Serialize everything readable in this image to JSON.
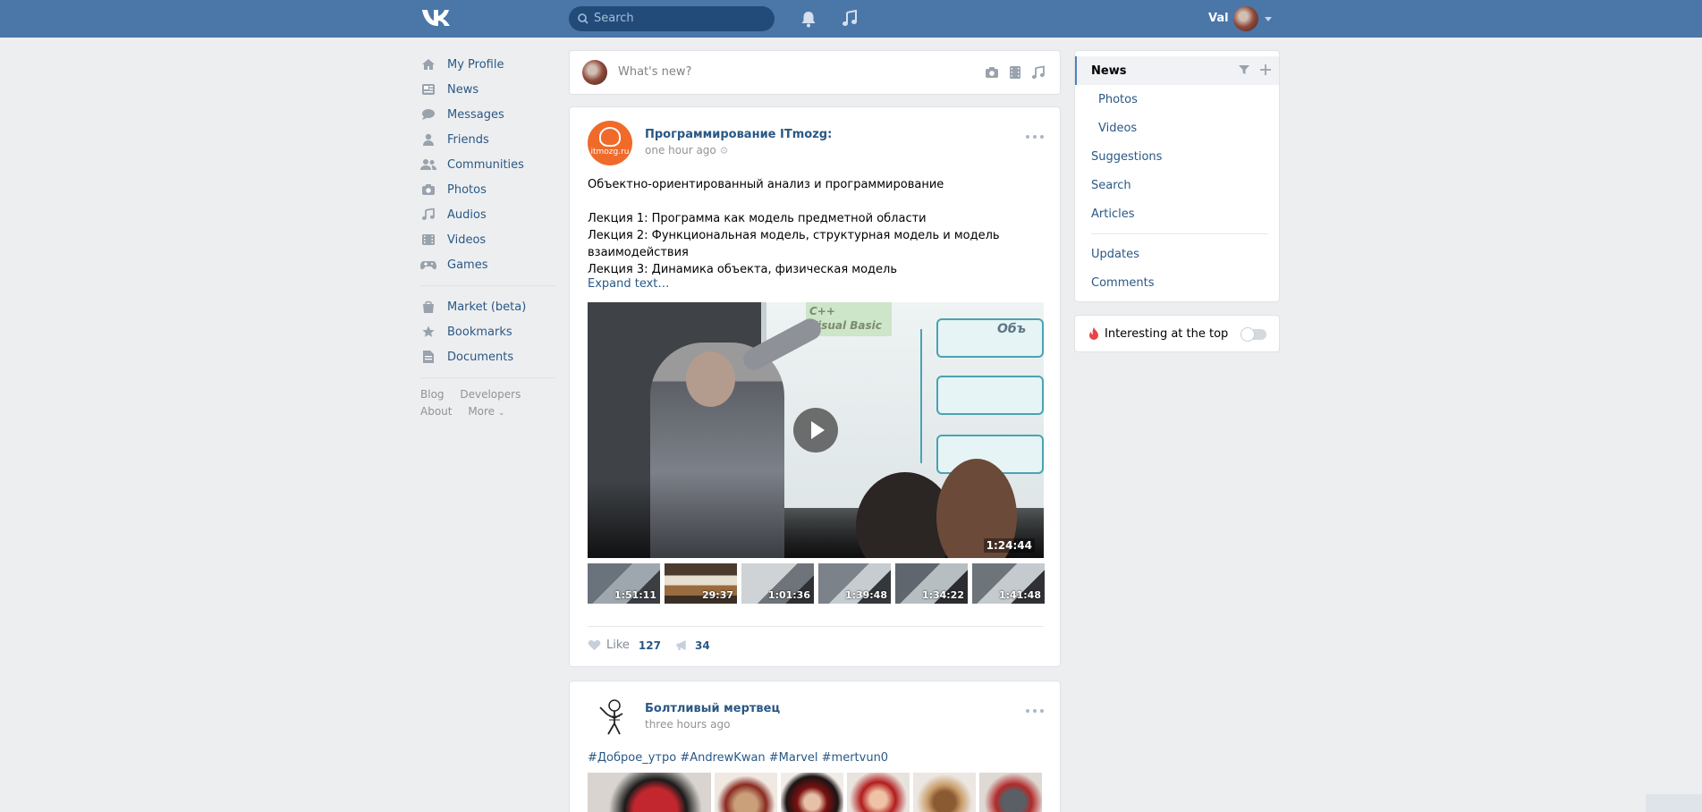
{
  "header": {
    "search_placeholder": "Search",
    "user_name": "Val",
    "logo": "vk-logo",
    "icons": [
      "bell-icon",
      "music-note-icon",
      "search-icon",
      "chevron-down-icon"
    ]
  },
  "left_nav": {
    "items": [
      {
        "label": "My Profile",
        "icon": "home-icon"
      },
      {
        "label": "News",
        "icon": "news-icon"
      },
      {
        "label": "Messages",
        "icon": "chat-icon"
      },
      {
        "label": "Friends",
        "icon": "person-icon"
      },
      {
        "label": "Communities",
        "icon": "people-icon"
      },
      {
        "label": "Photos",
        "icon": "camera-icon"
      },
      {
        "label": "Audios",
        "icon": "music-icon"
      },
      {
        "label": "Videos",
        "icon": "film-icon"
      },
      {
        "label": "Games",
        "icon": "gamepad-icon"
      }
    ],
    "items2": [
      {
        "label": "Market (beta)",
        "icon": "bag-icon"
      },
      {
        "label": "Bookmarks",
        "icon": "star-icon"
      },
      {
        "label": "Documents",
        "icon": "document-icon"
      }
    ],
    "footer": [
      "Blog",
      "Developers",
      "About",
      "More"
    ]
  },
  "composer": {
    "placeholder": "What's new?"
  },
  "post1": {
    "group": "Программирование ITmozg:",
    "time": "one hour ago",
    "avatar_text": "itmozg.ru",
    "lines": [
      "Объектно-ориентированный анализ и программирование",
      "",
      "Лекция 1: Программа как модель предметной области",
      "Лекция 2: Функциональная модель, структурная модель и модель взаимодействия",
      "Лекция 3: Динамика объекта, физическая модель"
    ],
    "expand": "Expand text…",
    "video_duration": "1:24:44",
    "video_board_text_1": "C++",
    "video_board_text_2": "Visual Basic",
    "video_board_text_3": "Объ",
    "thumbs": [
      "1:51:11",
      "29:37",
      "1:01:36",
      "1:39:48",
      "1:34:22",
      "1:41:48"
    ],
    "like_label": "Like",
    "like_count": "127",
    "share_count": "34"
  },
  "post2": {
    "group": "Болтливый мертвец",
    "time": "three hours ago",
    "tags": "#Доброе_утро #AndrewKwan #Marvel #mertvun0"
  },
  "right_nav": {
    "items": [
      {
        "label": "News",
        "active": true
      },
      {
        "label": "Photos",
        "sub": true
      },
      {
        "label": "Videos",
        "sub": true
      },
      {
        "label": "Suggestions"
      },
      {
        "label": "Search"
      },
      {
        "label": "Articles"
      },
      {
        "label": "Updates"
      },
      {
        "label": "Comments"
      }
    ]
  },
  "interesting": {
    "label": "Interesting at the top",
    "enabled": false
  },
  "colors": {
    "header": "#4a76a8",
    "link": "#2a5885",
    "background": "#edeef0"
  }
}
